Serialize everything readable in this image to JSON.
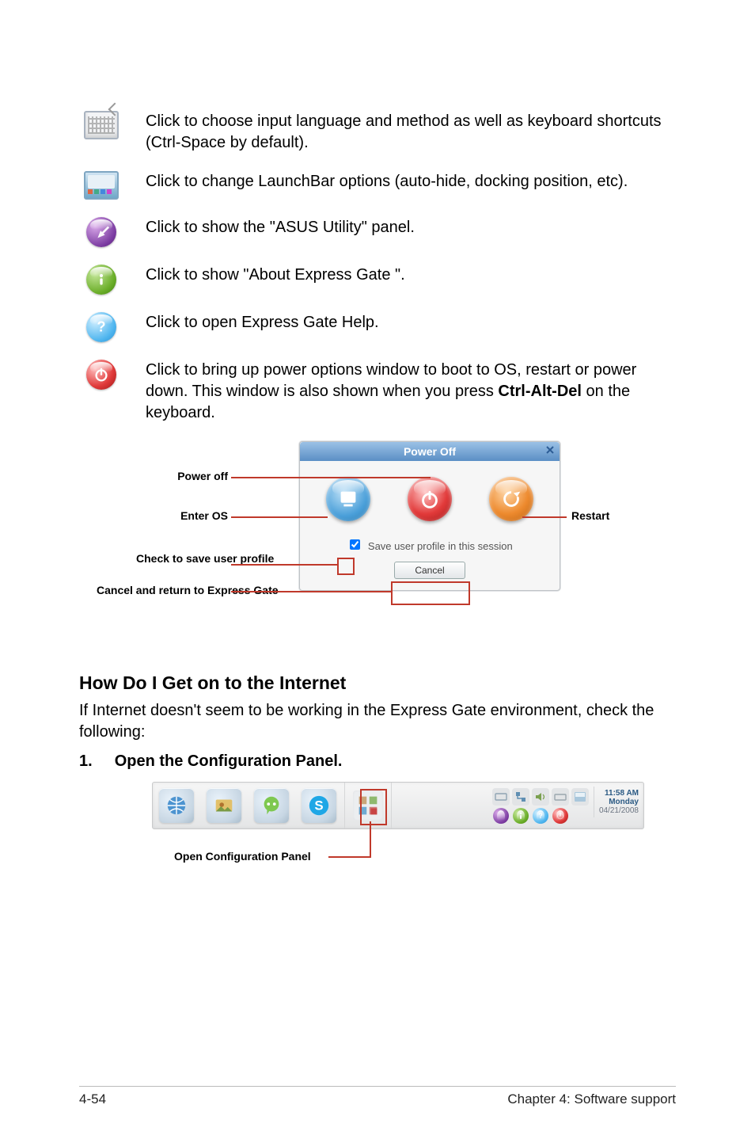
{
  "items": [
    {
      "key": "lang",
      "text": "Click to choose input language and method as well as keyboard shortcuts (Ctrl-Space by default)."
    },
    {
      "key": "launch",
      "text": "Click to change LaunchBar options (auto-hide, docking position, etc)."
    },
    {
      "key": "asus",
      "text": "Click to show the \"ASUS Utility\" panel."
    },
    {
      "key": "about",
      "text": "Click to show \"About Express Gate \"."
    },
    {
      "key": "help",
      "text": "Click to open Express Gate  Help."
    },
    {
      "key": "power",
      "text_pre": "Click to bring up power options window to boot to OS, restart or power down. This window is also shown when you press ",
      "bold": "Ctrl-Alt-Del",
      "text_post": " on the keyboard."
    }
  ],
  "power_dialog": {
    "title": "Power Off",
    "checkbox_label": "Save user profile in this session",
    "cancel_label": "Cancel"
  },
  "annotations": {
    "power_off": "Power off",
    "enter_os": "Enter OS",
    "restart": "Restart",
    "check_save": "Check to save user profile",
    "cancel_return": "Cancel and return to Express Gate"
  },
  "section_heading": "How Do I Get on to the Internet",
  "section_body": "If Internet doesn't seem to be working in the Express Gate  environment, check the following:",
  "step1_num": "1.",
  "step1_text": "Open the Configuration Panel.",
  "launchbar_callout": "Open Configuration Panel",
  "clock": {
    "time": "11:58 AM",
    "day": "Monday",
    "date": "04/21/2008"
  },
  "footer_left": "4-54",
  "footer_right": "Chapter 4: Software support"
}
